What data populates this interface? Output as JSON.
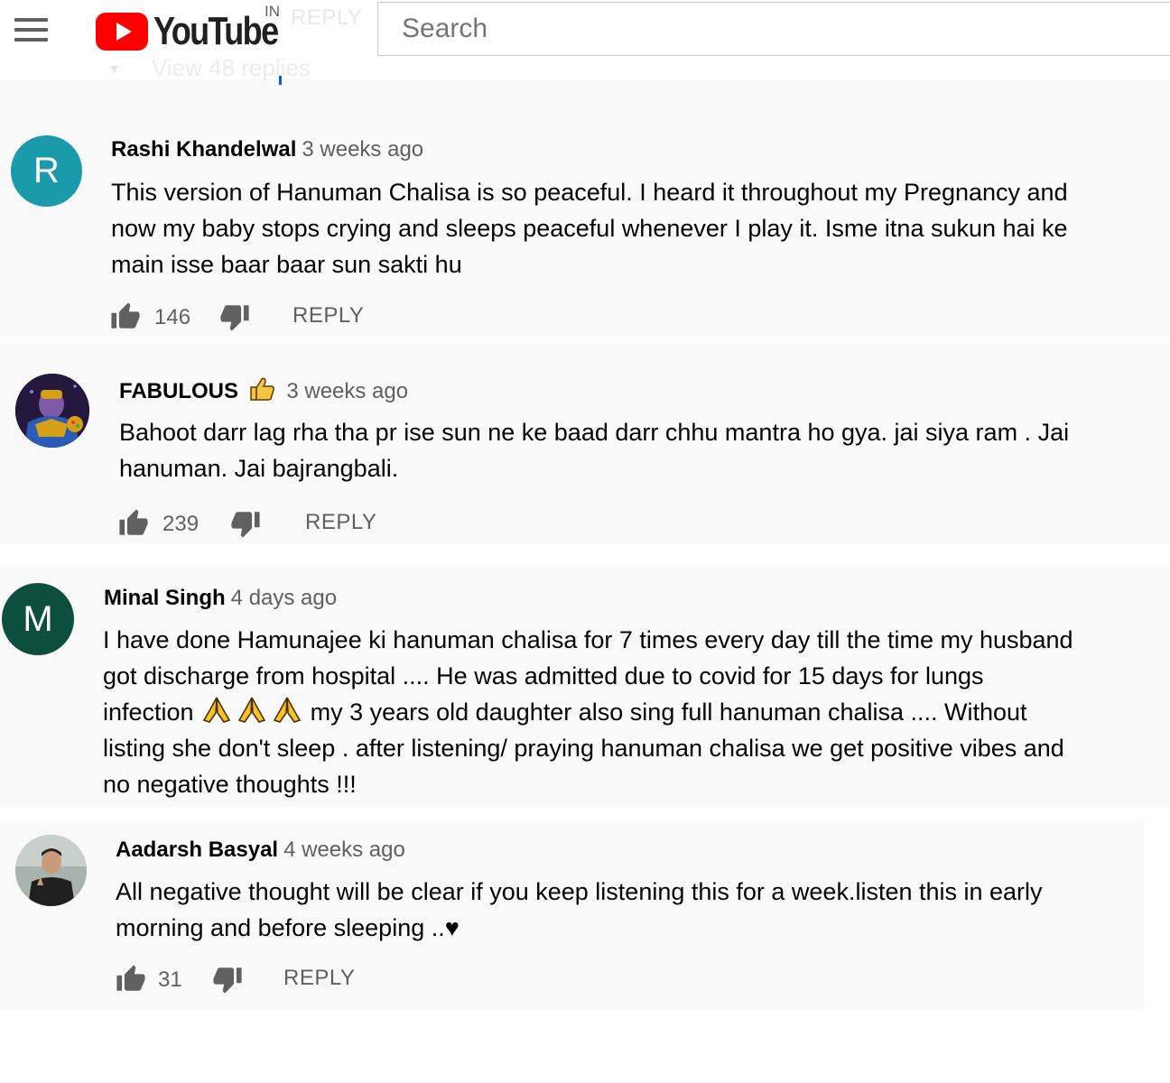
{
  "header": {
    "logo_text": "YouTube",
    "country_code": "IN",
    "search_placeholder": "Search",
    "behind_header_reply": "REPLY",
    "behind_header_view_replies": "View 48 replies"
  },
  "colors": {
    "brand_red": "#ff0000",
    "avatar_r": "#1a9bab",
    "avatar_m": "#0b4f3c",
    "comment_bg": "#f9f9f9",
    "secondary_text": "#606060"
  },
  "comments": [
    {
      "author": "Rashi Khandelwal",
      "time": "3 weeks ago",
      "avatar_letter": "R",
      "lines": [
        "This version  of Hanuman Chalisa is so peaceful. I heard it throughout my Pregnancy and",
        "now my baby stops crying and sleeps peaceful whenever I play it. Isme itna sukun hai ke",
        "main isse baar baar sun sakti hu"
      ],
      "likes": "146",
      "reply_label": "REPLY"
    },
    {
      "author": "FABULOUS",
      "author_emoji": "thumbs-up-icon",
      "time": "3 weeks ago",
      "avatar_icon": "thanos-avatar",
      "lines": [
        "Bahoot darr lag rha tha pr ise sun ne ke baad darr chhu mantra ho gya. jai siya ram . Jai",
        "hanuman. Jai bajrangbali."
      ],
      "likes": "239",
      "reply_label": "REPLY"
    },
    {
      "author": "Minal Singh",
      "time": "4 days ago",
      "avatar_letter": "M",
      "lines": [
        "I have done Hamunajee ki hanuman chalisa for 7 times every day till the time my husband",
        "got discharge from hospital .... He was admitted due to covid for 15 days for lungs",
        "infection",
        "my 3 years old daughter also sing full hanuman chalisa .... Without",
        "listing she don't sleep . after listening/ praying hanuman chalisa we get positive vibes and",
        "no negative thoughts !!!"
      ],
      "line3_emoji": "folded-hands-icon"
    },
    {
      "author": "Aadarsh Basyal",
      "time": "4 weeks ago",
      "avatar_icon": "person-photo-avatar",
      "lines": [
        "All negative thought will be clear if you keep listening this for a week.listen this in early",
        "morning and before sleeping ..♥"
      ],
      "likes": "31",
      "reply_label": "REPLY"
    }
  ]
}
